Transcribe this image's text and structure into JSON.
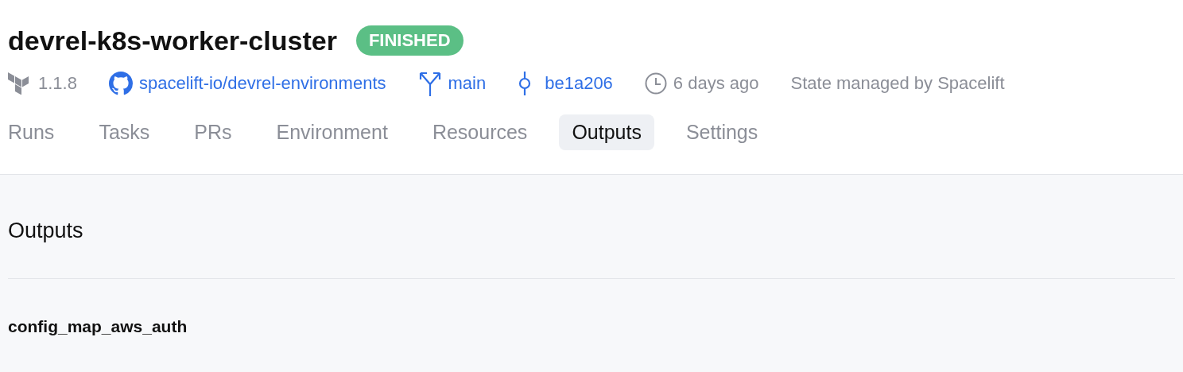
{
  "header": {
    "title": "devrel-k8s-worker-cluster",
    "status": {
      "label": "FINISHED",
      "color": "#5bbf85"
    }
  },
  "meta": [
    {
      "kind": "version",
      "text": "1.1.8"
    },
    {
      "kind": "repo",
      "text": "spacelift-io/devrel-environments"
    },
    {
      "kind": "branch",
      "text": "main"
    },
    {
      "kind": "commit",
      "text": "be1a206"
    },
    {
      "kind": "time",
      "text": "6 days ago"
    },
    {
      "kind": "state",
      "text": "State managed by Spacelift"
    }
  ],
  "tabs": [
    {
      "label": "Runs",
      "selected": false
    },
    {
      "label": "Tasks",
      "selected": false
    },
    {
      "label": "PRs",
      "selected": false
    },
    {
      "label": "Environment",
      "selected": false
    },
    {
      "label": "Resources",
      "selected": false
    },
    {
      "label": "Outputs",
      "selected": true
    },
    {
      "label": "Settings",
      "selected": false
    }
  ],
  "section": {
    "title": "Outputs",
    "outputs": [
      {
        "name": "config_map_aws_auth"
      }
    ]
  }
}
